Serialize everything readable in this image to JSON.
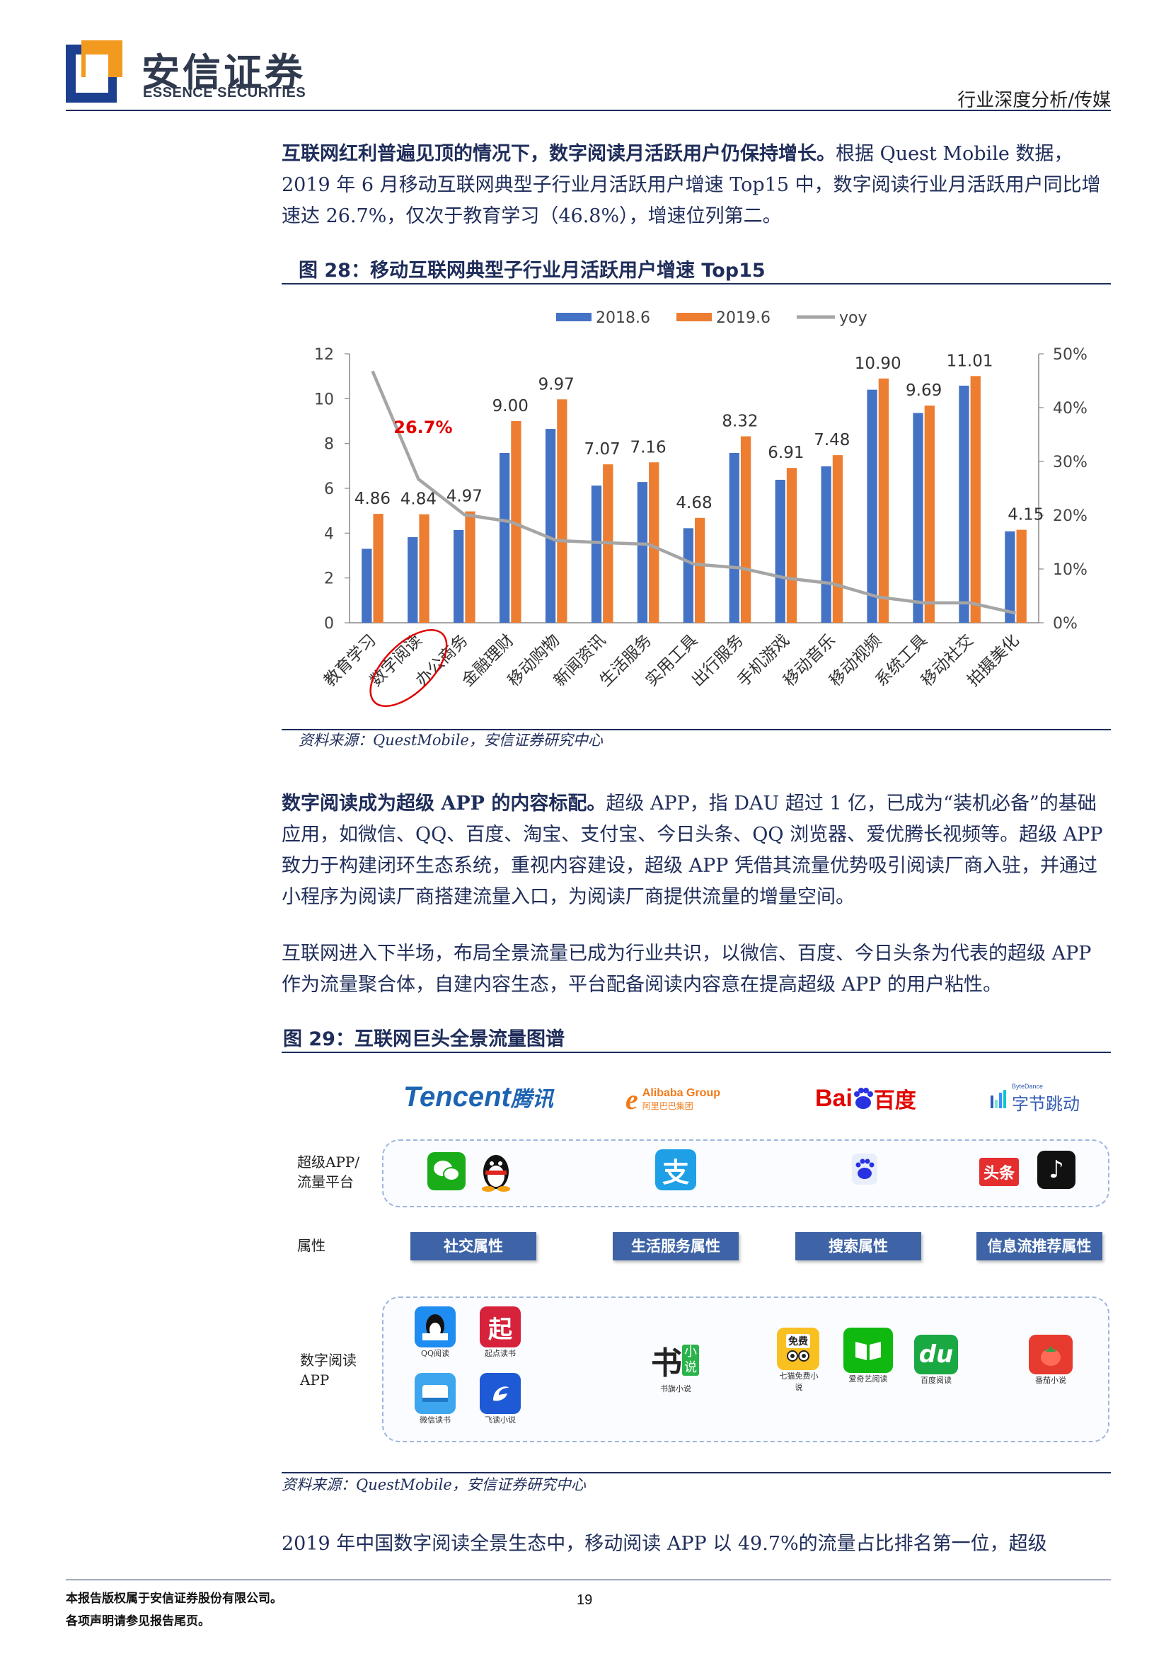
{
  "header": {
    "brand_cn": "安信证券",
    "brand_en": "ESSENCE SECURITIES",
    "category": "行业深度分析/传媒"
  },
  "para1": {
    "lead": "互联网红利普遍见顶的情况下，数字阅读月活跃用户仍保持增长。",
    "body": "根据 Quest Mobile 数据，2019 年 6 月移动互联网典型子行业月活跃用户增速 Top15 中，数字阅读行业月活跃用户同比增速达 26.7%，仅次于教育学习（46.8%），增速位列第二。"
  },
  "fig28": {
    "title": "图 28：移动互联网典型子行业月活跃用户增速 Top15",
    "source": "资料来源：QuestMobile，安信证券研究中心"
  },
  "chart_data": {
    "type": "bar",
    "categories": [
      "教育学习",
      "数字阅读",
      "办公商务",
      "金融理财",
      "移动购物",
      "新闻资讯",
      "生活服务",
      "实用工具",
      "出行服务",
      "手机游戏",
      "移动音乐",
      "移动视频",
      "系统工具",
      "移动社交",
      "拍摄美化"
    ],
    "series": [
      {
        "name": "2018.6",
        "values": [
          3.3,
          3.82,
          4.14,
          7.58,
          8.65,
          6.12,
          6.28,
          4.22,
          7.58,
          6.38,
          6.98,
          10.4,
          9.36,
          10.58,
          4.08
        ]
      },
      {
        "name": "2019.6",
        "values": [
          4.86,
          4.84,
          4.97,
          9.0,
          9.97,
          7.07,
          7.16,
          4.68,
          8.32,
          6.91,
          7.48,
          10.9,
          9.69,
          11.01,
          4.15
        ]
      },
      {
        "name": "yoy",
        "values": [
          46.8,
          26.7,
          20.1,
          18.8,
          15.3,
          14.9,
          14.6,
          10.9,
          10.2,
          8.3,
          7.3,
          4.8,
          3.7,
          3.7,
          1.8
        ]
      }
    ],
    "data_labels": [
      "4.86",
      "4.84",
      "4.97",
      "9.00",
      "9.97",
      "7.07",
      "7.16",
      "4.68",
      "8.32",
      "6.91",
      "7.48",
      "10.90",
      "9.69",
      "11.01",
      "4.15"
    ],
    "y_ticks": [
      "0",
      "2",
      "4",
      "6",
      "8",
      "10",
      "12"
    ],
    "y2_ticks": [
      "0%",
      "10%",
      "20%",
      "30%",
      "40%",
      "50%"
    ],
    "ylim": [
      0,
      12
    ],
    "y2lim": [
      0,
      50
    ],
    "annotation": "26.7%",
    "highlighted_category": "数字阅读",
    "legend_position": "top",
    "colors": {
      "s2018": "#4472c4",
      "s2019": "#ed7d31",
      "yoy": "#a5a5a5",
      "annotation": "#e00000"
    }
  },
  "para2": {
    "lead": "数字阅读成为超级 APP 的内容标配。",
    "body": "超级 APP，指 DAU 超过 1 亿，已成为“装机必备”的基础应用，如微信、QQ、百度、淘宝、支付宝、今日头条、QQ 浏览器、爱优腾长视频等。超级 APP 致力于构建闭环生态系统，重视内容建设，超级 APP 凭借其流量优势吸引阅读厂商入驻，并通过小程序为阅读厂商搭建流量入口，为阅读厂商提供流量的增量空间。"
  },
  "para3": {
    "body": "互联网进入下半场，布局全景流量已成为行业共识，以微信、百度、今日头条为代表的超级 APP 作为流量聚合体，自建内容生态，平台配备阅读内容意在提高超级 APP 的用户粘性。"
  },
  "fig29": {
    "title": "图 29：互联网巨头全景流量图谱",
    "source": "资料来源：QuestMobile，安信证券研究中心",
    "brands": {
      "tencent": "Tencent",
      "tencent_cn": "腾讯",
      "alibaba": "Alibaba Group",
      "alibaba_cn": "阿里巴巴集团",
      "baidu_a": "Bai",
      "baidu_b": "百度",
      "bytedance_small": "ByteDance",
      "bytedance": "字节跳动"
    },
    "row_labels": {
      "super_app": "超级APP/\n流量平台",
      "attribute": "属性",
      "reading_app": "数字阅读\nAPP"
    },
    "attributes": [
      "社交属性",
      "生活服务属性",
      "搜索属性",
      "信息流推荐属性"
    ],
    "super_icons": {
      "alipay": "支",
      "toutiao": "头条",
      "tiktok": "♪"
    },
    "reading_apps": {
      "qq_read": "QQ阅读",
      "qidian": "起点读书",
      "qidian_glyph": "起",
      "weixin_read": "微信读书",
      "feidu": "飞读小说",
      "shuqi": "书旗小说",
      "shuqi_glyph_a": "书",
      "shuqi_glyph_b": "小说",
      "qimao": "七猫免费小说",
      "qimao_badge": "免费",
      "iqiyi_read": "爱奇艺阅读",
      "baidu_read": "百度阅读",
      "baidu_read_glyph": "du",
      "fanqie": "番茄小说"
    }
  },
  "para4": {
    "body": "2019 年中国数字阅读全景生态中，移动阅读 APP 以 49.7%的流量占比排名第一位，超级"
  },
  "footer": {
    "line1": "本报告版权属于安信证券股份有限公司。",
    "line2": "各项声明请参见报告尾页。",
    "page": "19"
  }
}
